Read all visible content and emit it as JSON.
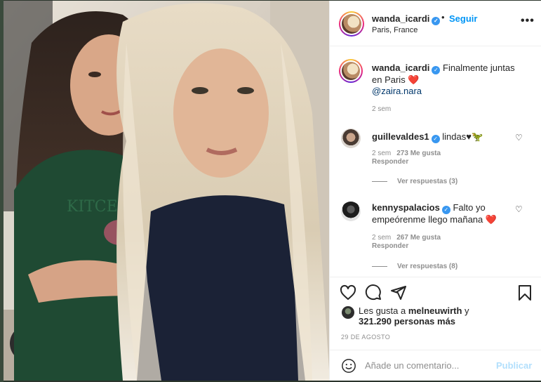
{
  "post": {
    "username": "wanda_icardi",
    "verified_icon": "verified-badge-icon",
    "follow_label": "Seguir",
    "separator": "•",
    "location": "Paris, France",
    "more_icon": "more-options-icon",
    "more_label": "•••"
  },
  "caption": {
    "username": "wanda_icardi",
    "text": "Finalmente juntas en Paris",
    "emoji": "❤️",
    "mention": "@zaira.nara",
    "time": "2 sem"
  },
  "comments": [
    {
      "username": "guillevaldes1",
      "text": "lindas♥",
      "emoji": "🦖",
      "time": "2 sem",
      "likes": "273 Me gusta",
      "reply_label": "Responder",
      "view_replies": "Ver respuestas (3)"
    },
    {
      "username": "kennyspalacios",
      "text": "Falto yo empeórenme llego mañana",
      "emoji": "❤️",
      "time": "2 sem",
      "likes": "267 Me gusta",
      "reply_label": "Responder",
      "view_replies": "Ver respuestas (8)"
    }
  ],
  "actions": {
    "icons": [
      "heart-icon",
      "comment-icon",
      "share-icon",
      "bookmark-icon"
    ],
    "likes_prefix": "Les gusta a",
    "likes_user": "melneuwirth",
    "likes_conj": "y",
    "likes_count": "321.290 personas más",
    "date": "29 DE AGOSTO"
  },
  "add_comment": {
    "emoji_icon": "smiley-icon",
    "placeholder": "Añade un comentario...",
    "publish_label": "Publicar"
  },
  "colors": {
    "accent": "#0095f6",
    "publish_disabled": "#b2dffc",
    "verified": "#3897f0",
    "muted": "#8e8e8e",
    "heart_emoji": "#ed4956"
  }
}
